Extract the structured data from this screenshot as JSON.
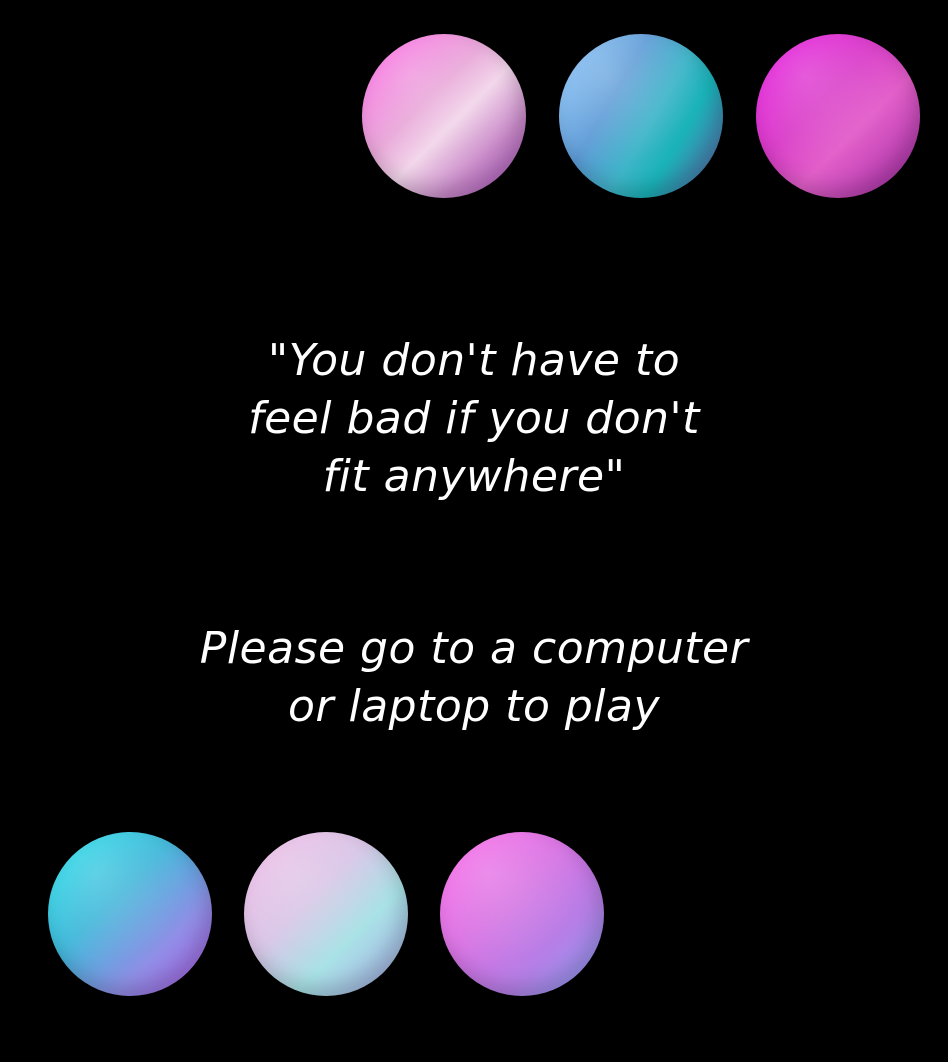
{
  "background_color": "#000000",
  "text_color": "#ffffff",
  "quote": {
    "lines": [
      "\"You don't have to",
      "feel bad if you don't",
      "fit anywhere\""
    ]
  },
  "notice": {
    "lines": [
      "Please go to a computer",
      "or laptop to play"
    ]
  },
  "orbs": {
    "top": [
      {
        "name": "pink-orb",
        "colors": [
          "#ff5ce5",
          "#f2d6ea",
          "#b04fc7"
        ]
      },
      {
        "name": "blue-teal-orb",
        "colors": [
          "#8fcaff",
          "#19b3b8",
          "#6f5fb0"
        ]
      },
      {
        "name": "magenta-orb",
        "colors": [
          "#e80ce0",
          "#e25fc9",
          "#a12aa6"
        ]
      }
    ],
    "bottom": [
      {
        "name": "cyan-violet-orb",
        "colors": [
          "#19e0ea",
          "#8f8fe6",
          "#b45dee"
        ]
      },
      {
        "name": "pastel-orb",
        "colors": [
          "#f1b7e6",
          "#a9e2e6",
          "#a7a7e8"
        ]
      },
      {
        "name": "pink-blue-orb",
        "colors": [
          "#ff62ea",
          "#b47fe6",
          "#8fa9ff"
        ]
      }
    ]
  }
}
